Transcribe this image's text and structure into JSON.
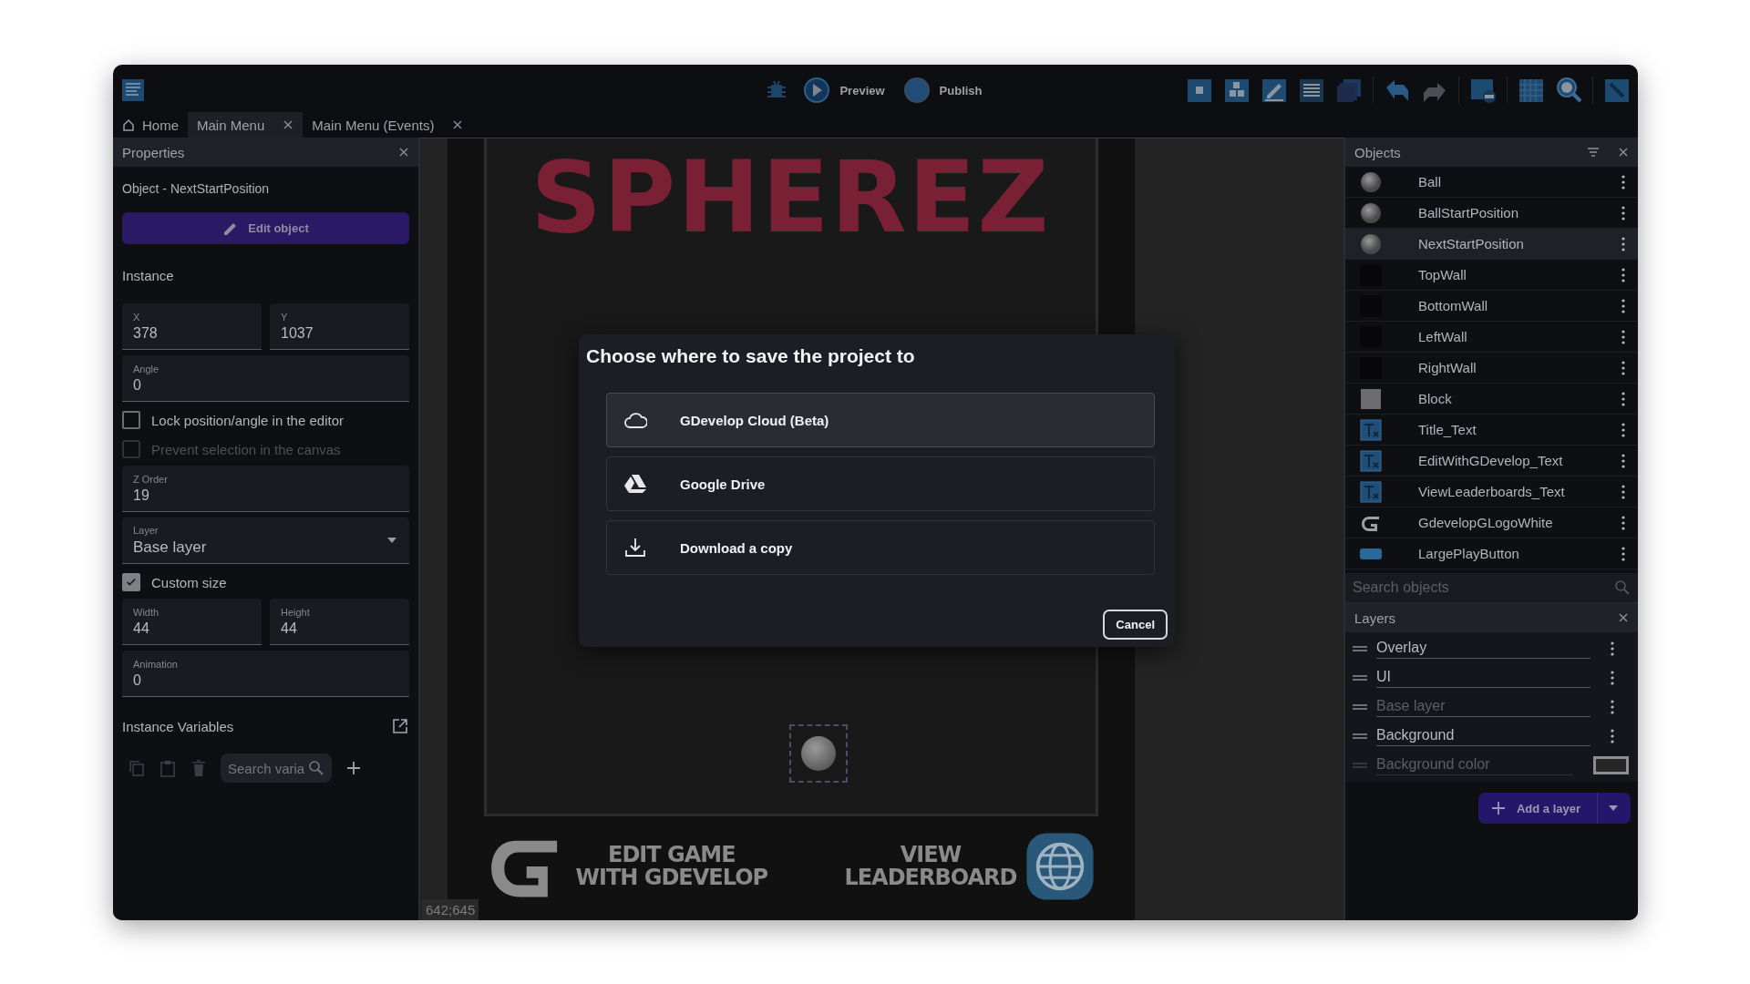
{
  "toolbar": {
    "buttons": [
      {
        "label": "Preview",
        "kind": "preview"
      },
      {
        "label": "Publish",
        "kind": "publish"
      }
    ]
  },
  "tabs": [
    {
      "label": "Home",
      "kind": "home",
      "selected": false,
      "closable": false
    },
    {
      "label": "Main Menu",
      "kind": "scene",
      "selected": true,
      "closable": true
    },
    {
      "label": "Main Menu (Events)",
      "kind": "events",
      "selected": false,
      "closable": true
    }
  ],
  "properties": {
    "title": "Properties",
    "object_label": "Object  - NextStartPosition",
    "edit_button": "Edit object",
    "section": "Instance",
    "items": [
      {
        "kind": "fields",
        "fields": [
          {
            "label": "X",
            "value": "378"
          },
          {
            "label": "Y",
            "value": "1037"
          }
        ]
      },
      {
        "kind": "fields",
        "fields": [
          {
            "label": "Angle",
            "value": "0"
          }
        ]
      },
      {
        "kind": "checkbox",
        "label": "Lock position/angle in the editor",
        "checked": false,
        "disabled": false
      },
      {
        "kind": "checkbox",
        "label": "Prevent selection in the canvas",
        "checked": false,
        "disabled": true
      },
      {
        "kind": "fields",
        "fields": [
          {
            "label": "Z Order",
            "value": "19"
          }
        ]
      },
      {
        "kind": "select",
        "label": "Layer",
        "value": "Base layer"
      },
      {
        "kind": "checkbox",
        "label": "Custom size",
        "checked": true,
        "disabled": false
      },
      {
        "kind": "fields",
        "fields": [
          {
            "label": "Width",
            "value": "44"
          },
          {
            "label": "Height",
            "value": "44"
          }
        ]
      },
      {
        "kind": "fields",
        "fields": [
          {
            "label": "Animation",
            "value": "0"
          }
        ]
      }
    ],
    "variables_title": "Instance Variables",
    "variables_search": {
      "placeholder": "Search varia"
    }
  },
  "canvas": {
    "game_title": "SPHEREZ",
    "edit_lines": [
      "EDIT GAME",
      "WITH GDEVELOP"
    ],
    "leaderboard_lines": [
      "VIEW",
      "LEADERBOARD"
    ],
    "coordinates": "642;645"
  },
  "dialog": {
    "title": "Choose where to save the project to",
    "options": [
      {
        "label": "GDevelop Cloud (Beta)",
        "kind": "cloud",
        "selected": true
      },
      {
        "label": "Google Drive",
        "kind": "drive",
        "selected": false
      },
      {
        "label": "Download a copy",
        "kind": "download",
        "selected": false
      }
    ],
    "cancel": "Cancel"
  },
  "objects": {
    "title": "Objects",
    "items": [
      {
        "name": "Ball",
        "kind": "sphere",
        "selected": false
      },
      {
        "name": "BallStartPosition",
        "kind": "sphere",
        "selected": false
      },
      {
        "name": "NextStartPosition",
        "kind": "sphere",
        "selected": true
      },
      {
        "name": "TopWall",
        "kind": "blank",
        "selected": false
      },
      {
        "name": "BottomWall",
        "kind": "blank",
        "selected": false
      },
      {
        "name": "LeftWall",
        "kind": "blank",
        "selected": false
      },
      {
        "name": "RightWall",
        "kind": "blank",
        "selected": false
      },
      {
        "name": "Block",
        "kind": "block",
        "selected": false
      },
      {
        "name": "Title_Text",
        "kind": "text",
        "selected": false
      },
      {
        "name": "EditWithGDevelop_Text",
        "kind": "text",
        "selected": false
      },
      {
        "name": "ViewLeaderboards_Text",
        "kind": "text",
        "selected": false
      },
      {
        "name": "GdevelopGLogoWhite",
        "kind": "logo",
        "selected": false
      },
      {
        "name": "LargePlayButton",
        "kind": "button",
        "selected": false
      }
    ],
    "search": {
      "placeholder": "Search objects"
    }
  },
  "layers": {
    "title": "Layers",
    "items": [
      {
        "name": "Overlay",
        "visible": true
      },
      {
        "name": "UI",
        "visible": true
      },
      {
        "name": "Base layer",
        "visible": false
      },
      {
        "name": "Background",
        "visible": true
      }
    ],
    "background_label": "Background color",
    "add_button": "Add a layer"
  }
}
